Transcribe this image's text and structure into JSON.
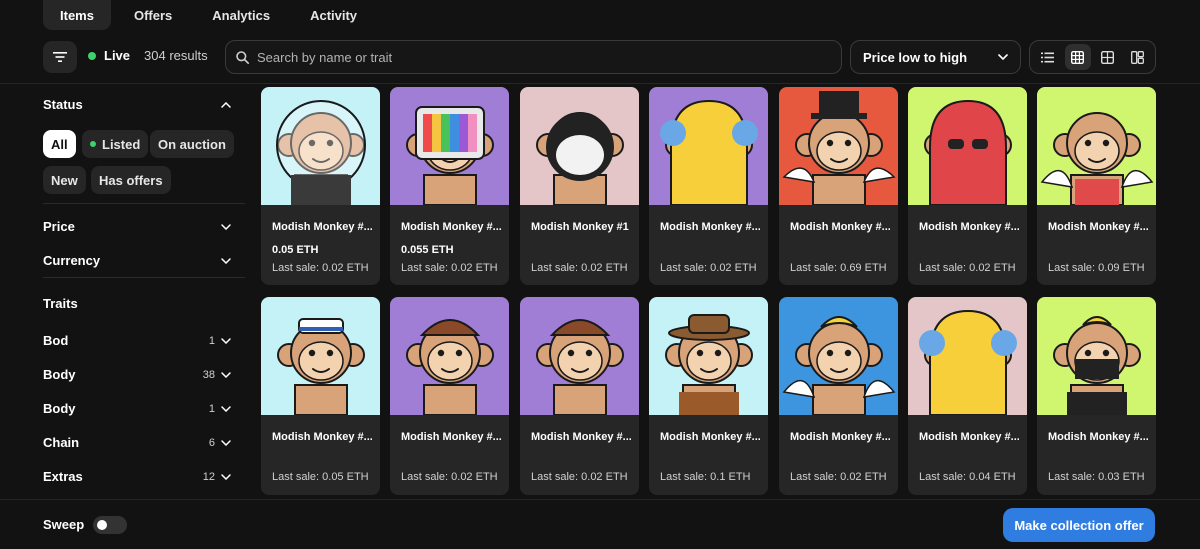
{
  "tabs": [
    {
      "label": "Items",
      "active": true
    },
    {
      "label": "Offers",
      "active": false
    },
    {
      "label": "Analytics",
      "active": false
    },
    {
      "label": "Activity",
      "active": false
    }
  ],
  "toolbar": {
    "filter_icon": "filter-lines-icon",
    "live_label": "Live",
    "result_count": "304 results",
    "search_placeholder": "Search by name or trait",
    "sort_value": "Price low to high",
    "view_modes": [
      "list",
      "grid-dense",
      "grid",
      "split"
    ],
    "active_view": "grid-dense"
  },
  "sidebar": {
    "status": {
      "title": "Status",
      "chips": [
        {
          "label": "All",
          "active": true
        },
        {
          "label": "Listed",
          "active": false
        },
        {
          "label": "On auction",
          "active": false
        },
        {
          "label": "New",
          "active": false
        },
        {
          "label": "Has offers",
          "active": false
        }
      ]
    },
    "price_label": "Price",
    "currency_label": "Currency",
    "traits": {
      "title": "Traits",
      "items": [
        {
          "label": "Bod",
          "count": "1"
        },
        {
          "label": "Body",
          "count": "38"
        },
        {
          "label": "Body",
          "count": "1"
        },
        {
          "label": "Chain",
          "count": "6"
        },
        {
          "label": "Extras",
          "count": "12"
        }
      ]
    }
  },
  "cards": [
    {
      "name": "Modish Monkey #...",
      "price": "0.05 ETH",
      "last_sale": "Last sale: 0.02 ETH",
      "bg": "#c4f2f6",
      "accessory": "helmet"
    },
    {
      "name": "Modish Monkey #...",
      "price": "0.055 ETH",
      "last_sale": "Last sale: 0.02 ETH",
      "bg": "#a07ed6",
      "accessory": "tv"
    },
    {
      "name": "Modish Monkey #1",
      "price": "",
      "last_sale": "Last sale: 0.02 ETH",
      "bg": "#e4c6c9",
      "accessory": "panda"
    },
    {
      "name": "Modish Monkey #...",
      "price": "",
      "last_sale": "Last sale: 0.02 ETH",
      "bg": "#a07ed6",
      "accessory": "hoodie"
    },
    {
      "name": "Modish Monkey #...",
      "price": "",
      "last_sale": "Last sale: 0.69 ETH",
      "bg": "#e6593e",
      "accessory": "tophat"
    },
    {
      "name": "Modish Monkey #...",
      "price": "",
      "last_sale": "Last sale: 0.02 ETH",
      "bg": "#d0f56f",
      "accessory": "redhood"
    },
    {
      "name": "Modish Monkey #...",
      "price": "",
      "last_sale": "Last sale: 0.09 ETH",
      "bg": "#d0f56f",
      "accessory": "wings"
    },
    {
      "name": "Modish Monkey #...",
      "price": "",
      "last_sale": "Last sale: 0.05 ETH",
      "bg": "#c4f2f6",
      "accessory": "sailor"
    },
    {
      "name": "Modish Monkey #...",
      "price": "",
      "last_sale": "Last sale: 0.02 ETH",
      "bg": "#a07ed6",
      "accessory": "brownhat"
    },
    {
      "name": "Modish Monkey #...",
      "price": "",
      "last_sale": "Last sale: 0.02 ETH",
      "bg": "#a07ed6",
      "accessory": "brownhat"
    },
    {
      "name": "Modish Monkey #...",
      "price": "",
      "last_sale": "Last sale: 0.1 ETH",
      "bg": "#c4f2f6",
      "accessory": "cowboy"
    },
    {
      "name": "Modish Monkey #...",
      "price": "",
      "last_sale": "Last sale: 0.02 ETH",
      "bg": "#3c95de",
      "accessory": "banana"
    },
    {
      "name": "Modish Monkey #...",
      "price": "",
      "last_sale": "Last sale: 0.04 ETH",
      "bg": "#e4c6c9",
      "accessory": "hoodie"
    },
    {
      "name": "Modish Monkey #...",
      "price": "",
      "last_sale": "Last sale: 0.03 ETH",
      "bg": "#d0f56f",
      "accessory": "ninja"
    }
  ],
  "footer": {
    "sweep_label": "Sweep",
    "sweep_on": false,
    "offer_button": "Make collection offer"
  },
  "colors": {
    "background": "#121212",
    "surface": "#262626",
    "accent": "#2f7de1",
    "live_green": "#3fd16b"
  }
}
